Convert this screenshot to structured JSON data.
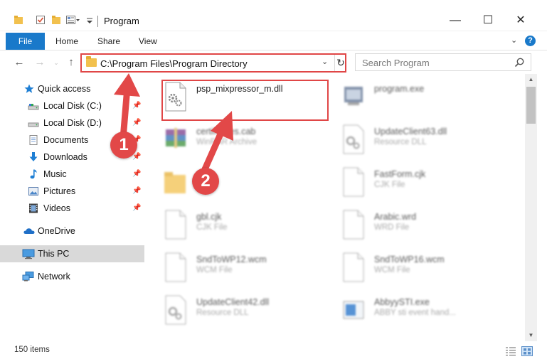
{
  "window": {
    "title": "Program",
    "controls": {
      "minimize": "—",
      "maximize": "☐",
      "close": "✕"
    }
  },
  "ribbon": {
    "tabs": [
      "File",
      "Home",
      "Share",
      "View"
    ],
    "help": "?"
  },
  "address_bar": {
    "path": "C:\\Program Files\\Program Directory",
    "search_placeholder": "Search Program"
  },
  "sidebar": {
    "items": [
      {
        "label": "Quick access",
        "icon": "star-icon",
        "pinned": false
      },
      {
        "label": "Local Disk (C:)",
        "icon": "drive-icon",
        "pinned": true
      },
      {
        "label": "Local Disk (D:)",
        "icon": "drive-icon",
        "pinned": true
      },
      {
        "label": "Documents",
        "icon": "documents-icon",
        "pinned": true
      },
      {
        "label": "Downloads",
        "icon": "downloads-icon",
        "pinned": true
      },
      {
        "label": "Music",
        "icon": "music-icon",
        "pinned": true
      },
      {
        "label": "Pictures",
        "icon": "pictures-icon",
        "pinned": true
      },
      {
        "label": "Videos",
        "icon": "videos-icon",
        "pinned": true
      },
      {
        "label": "OneDrive",
        "icon": "onedrive-icon",
        "pinned": false
      },
      {
        "label": "This PC",
        "icon": "pc-icon",
        "pinned": false,
        "selected": true
      },
      {
        "label": "Network",
        "icon": "network-icon",
        "pinned": false
      }
    ]
  },
  "files": [
    {
      "name": "psp_mixpressor_m.dll",
      "type": "",
      "icon": "dll-gear-icon",
      "highlighted": true
    },
    {
      "name": "program.exe",
      "type": "",
      "icon": "exe-icon"
    },
    {
      "name": "certificates.cab",
      "type": "WinRAR Archive",
      "icon": "winrar-icon"
    },
    {
      "name": "UpdateClient63.dll",
      "type": "Resource DLL",
      "icon": "dll-gear-icon"
    },
    {
      "name": "",
      "type": "",
      "icon": "folder-icon"
    },
    {
      "name": "FastForm.cjk",
      "type": "CJK File",
      "icon": "blank-file-icon"
    },
    {
      "name": "gbl.cjk",
      "type": "CJK File",
      "icon": "blank-file-icon"
    },
    {
      "name": "Arabic.wrd",
      "type": "WRD File",
      "icon": "blank-file-icon"
    },
    {
      "name": "SndToWP12.wcm",
      "type": "WCM File",
      "icon": "blank-file-icon"
    },
    {
      "name": "SndToWP16.wcm",
      "type": "WCM File",
      "icon": "blank-file-icon"
    },
    {
      "name": "UpdateClient42.dll",
      "type": "Resource DLL",
      "icon": "dll-gear-icon"
    },
    {
      "name": "AbbyySTI.exe",
      "type": "ABBY sti event hand...",
      "icon": "exe-icon"
    }
  ],
  "annotations": {
    "marker1": "1",
    "marker2": "2"
  },
  "status": {
    "item_count": "150 items"
  },
  "colors": {
    "accent": "#1979ca",
    "highlight": "#e04646",
    "marker": "#e24848"
  }
}
